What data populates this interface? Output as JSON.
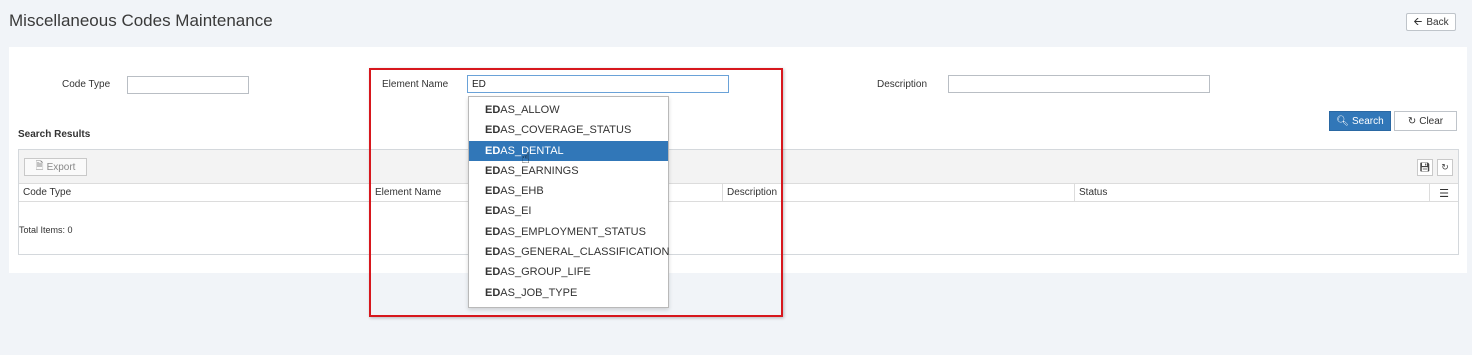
{
  "page": {
    "title": "Miscellaneous Codes Maintenance",
    "back_label": "Back"
  },
  "filters": {
    "code_type_label": "Code Type",
    "code_type_value": "",
    "element_name_label": "Element Name",
    "element_name_value": "ED",
    "description_label": "Description",
    "description_value": ""
  },
  "actions": {
    "search_label": "Search",
    "clear_label": "Clear"
  },
  "results": {
    "title": "Search Results",
    "export_label": "Export",
    "columns": [
      "Code Type",
      "Element Name",
      "Description",
      "Status"
    ],
    "total_text": "Total Items: 0"
  },
  "autocomplete": {
    "match": "ED",
    "selected_index": 2,
    "items": [
      {
        "prefix": "ED",
        "rest": "AS_ALLOW"
      },
      {
        "prefix": "ED",
        "rest": "AS_COVERAGE_STATUS"
      },
      {
        "prefix": "ED",
        "rest": "AS_DENTAL"
      },
      {
        "prefix": "ED",
        "rest": "AS_EARNINGS"
      },
      {
        "prefix": "ED",
        "rest": "AS_EHB"
      },
      {
        "prefix": "ED",
        "rest": "AS_EI"
      },
      {
        "prefix": "ED",
        "rest": "AS_EMPLOYMENT_STATUS"
      },
      {
        "prefix": "ED",
        "rest": "AS_GENERAL_CLASSIFICATION"
      },
      {
        "prefix": "ED",
        "rest": "AS_GROUP_LIFE"
      },
      {
        "prefix": "ED",
        "rest": "AS_JOB_TYPE"
      }
    ]
  },
  "colors": {
    "accent": "#3177b8",
    "highlight_box": "#d7171d"
  }
}
